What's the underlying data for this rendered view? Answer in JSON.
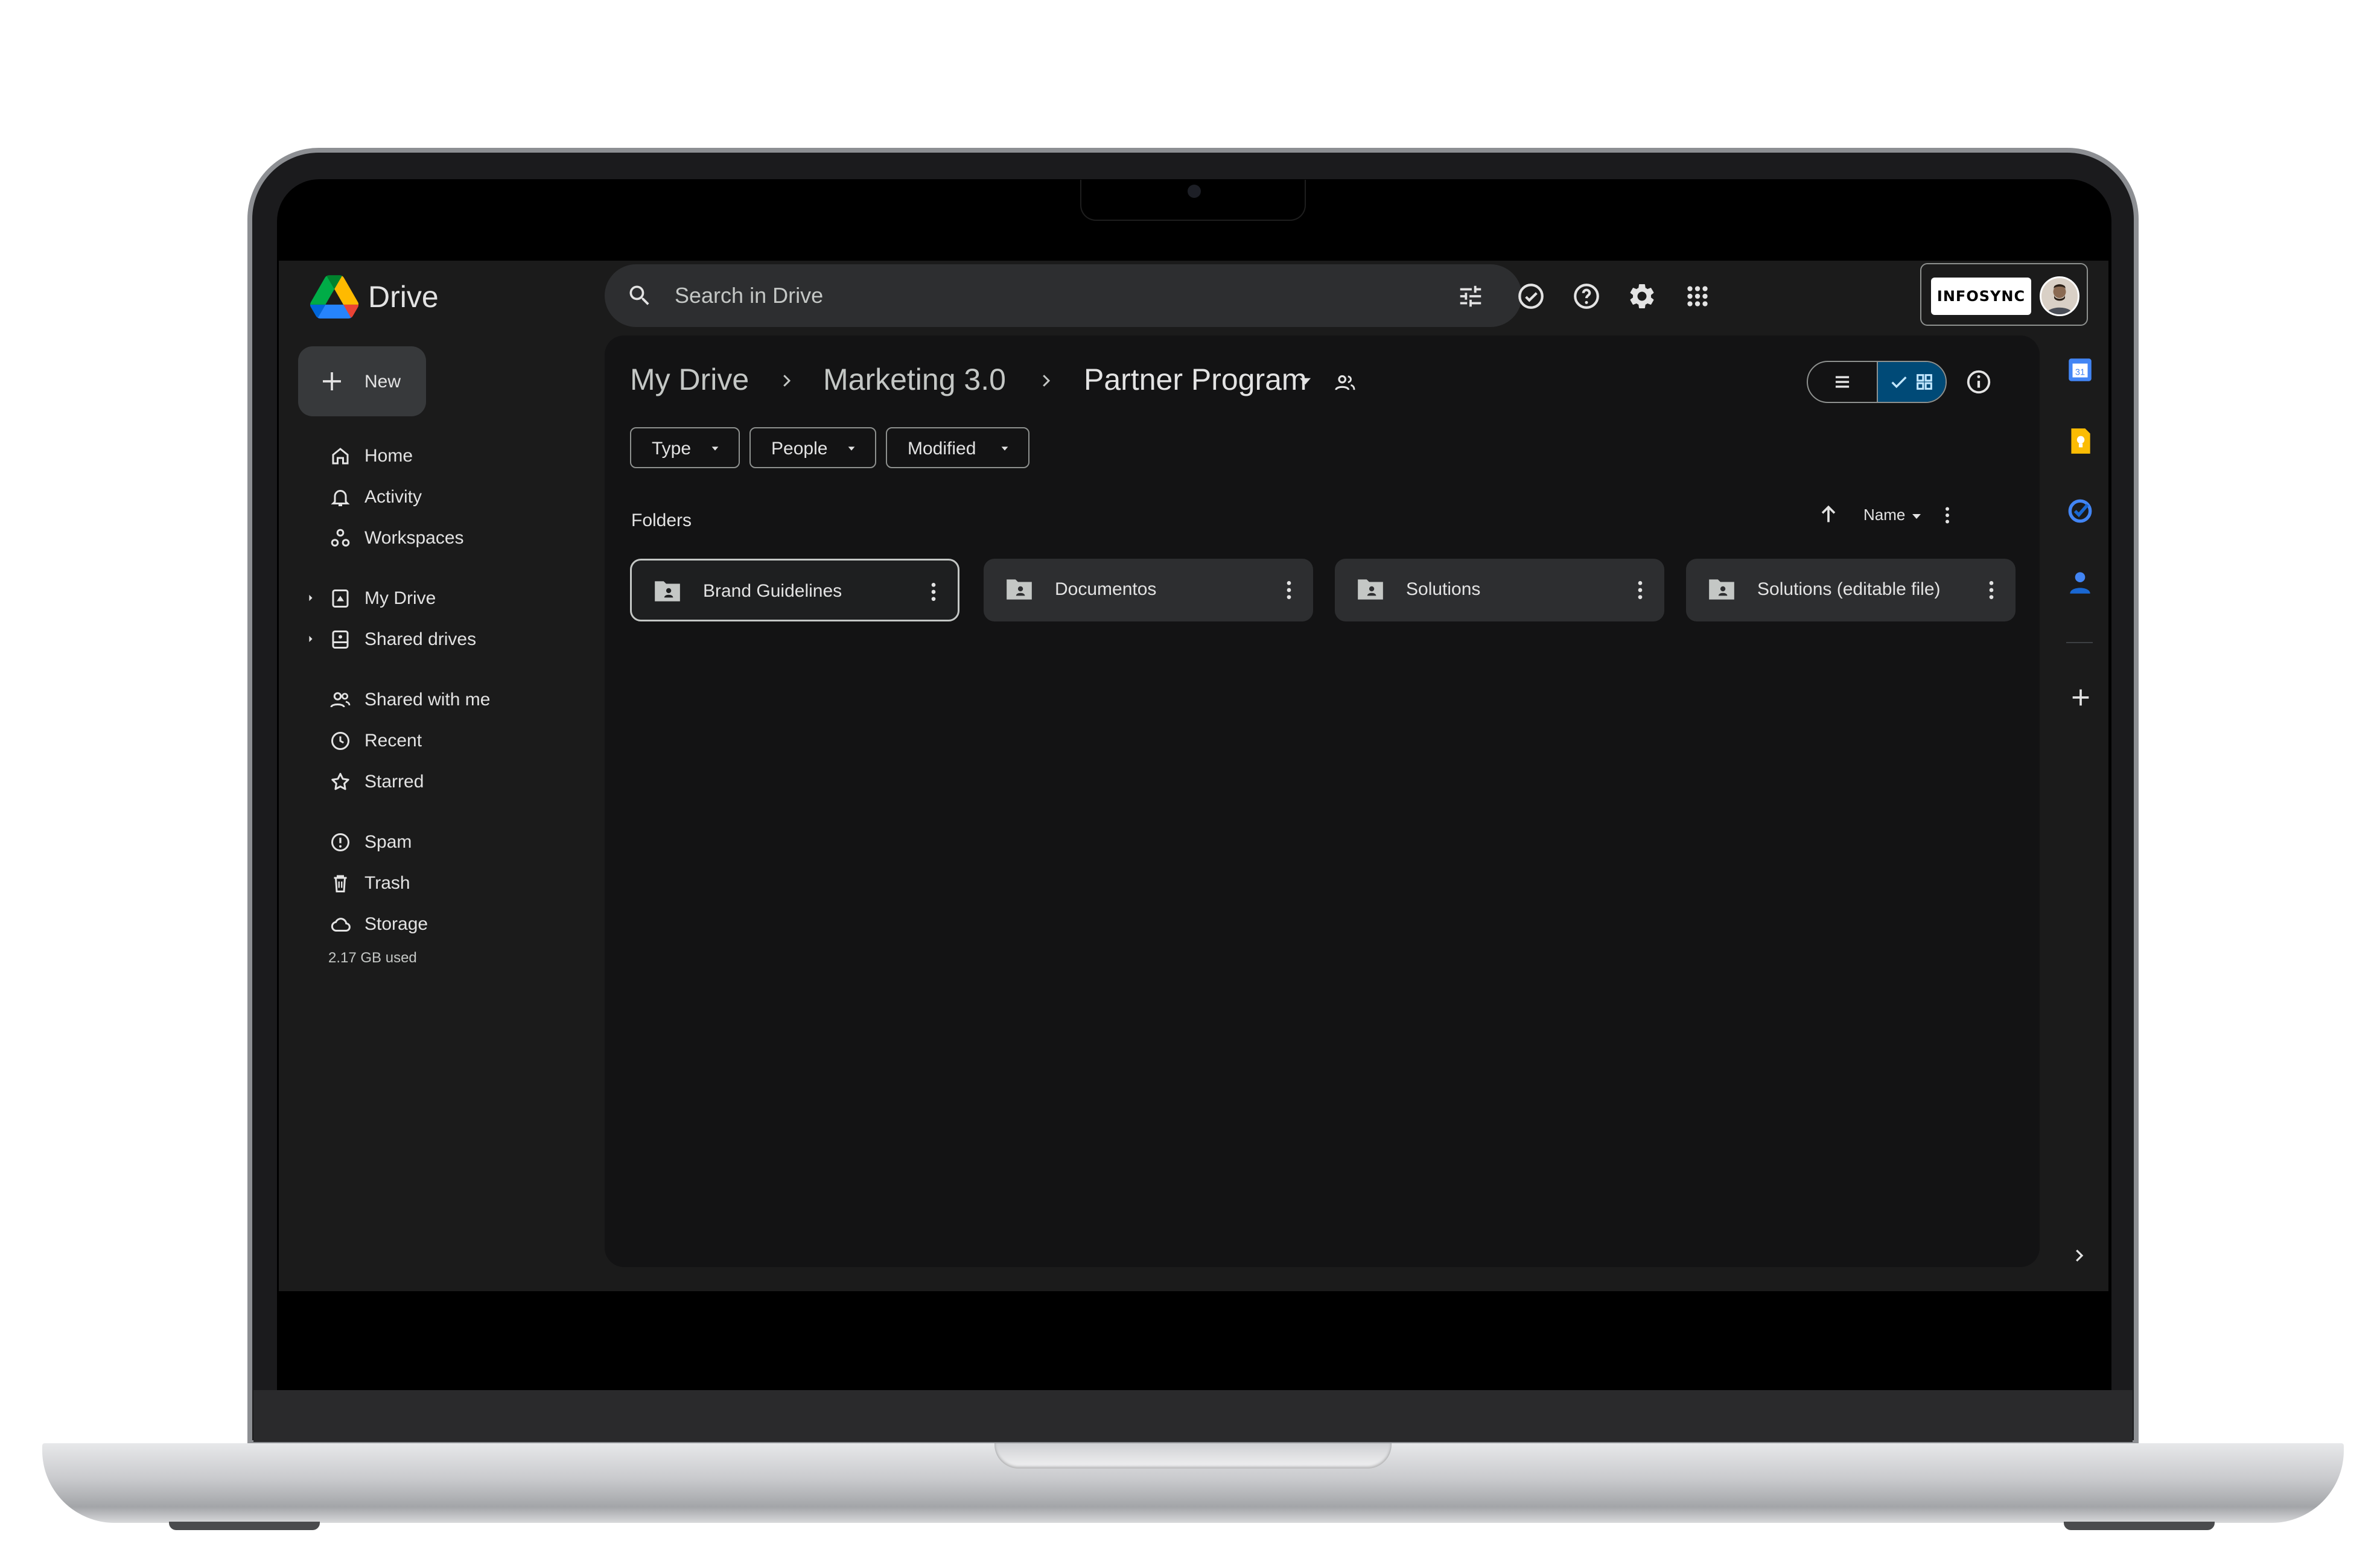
{
  "app": {
    "name": "Drive"
  },
  "search": {
    "placeholder": "Search in Drive"
  },
  "account": {
    "brand": "INFOSYNC"
  },
  "sidebar": {
    "new_label": "New",
    "items": [
      {
        "label": "Home",
        "icon": "home-icon"
      },
      {
        "label": "Activity",
        "icon": "bell-icon"
      },
      {
        "label": "Workspaces",
        "icon": "workspaces-icon"
      },
      {
        "label": "My Drive",
        "icon": "my-drive-icon"
      },
      {
        "label": "Shared drives",
        "icon": "shared-drives-icon"
      },
      {
        "label": "Shared with me",
        "icon": "people-icon"
      },
      {
        "label": "Recent",
        "icon": "clock-icon"
      },
      {
        "label": "Starred",
        "icon": "star-icon"
      },
      {
        "label": "Spam",
        "icon": "spam-icon"
      },
      {
        "label": "Trash",
        "icon": "trash-icon"
      },
      {
        "label": "Storage",
        "icon": "cloud-icon"
      }
    ],
    "storage_used": "2.17 GB used"
  },
  "breadcrumb": [
    "My Drive",
    "Marketing 3.0",
    "Partner Program"
  ],
  "filters": [
    "Type",
    "People",
    "Modified"
  ],
  "section": {
    "title": "Folders",
    "sort_label": "Name"
  },
  "folders": [
    {
      "name": "Brand Guidelines",
      "selected": true
    },
    {
      "name": "Documentos",
      "selected": false
    },
    {
      "name": "Solutions",
      "selected": false
    },
    {
      "name": "Solutions (editable file)",
      "selected": false
    }
  ],
  "colors": {
    "background": "#1b1b1b",
    "panel": "#131314",
    "accent_selected_view": "#004a77",
    "text": "#e3e3e3"
  }
}
